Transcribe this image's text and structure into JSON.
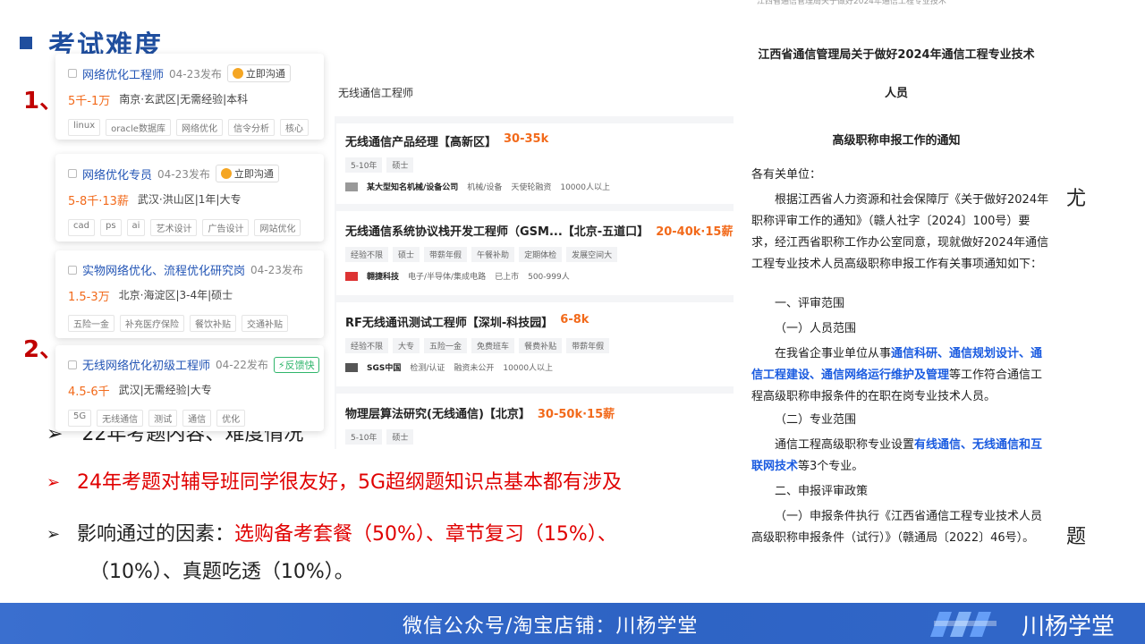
{
  "slide": {
    "title": "考试难度",
    "section_1": "1、",
    "section_2": "2、",
    "partial_right_char": "尤",
    "partial_right_char2": "题"
  },
  "bullets": {
    "hidden_line": "22年考题内容、难度情况",
    "b1": "24年考题对辅导班同学很友好，5G超纲题知识点基本都有涉及",
    "b2_prefix": "影响通过的因素：",
    "b2_red": "选购备考套餐（50%）、章节复习（15%）、",
    "b2_cont": "（10%）、真题吃透（10%）。"
  },
  "left_cards": [
    {
      "title": "网络优化工程师",
      "date": "04-23发布",
      "btn": "立即沟通",
      "salary": "5千-1万",
      "loc": "南京·玄武区|无需经验|本科",
      "tags": [
        "linux",
        "oracle数据库",
        "网络优化",
        "信令分析",
        "核心"
      ]
    },
    {
      "title": "网络优化专员",
      "date": "04-23发布",
      "btn": "立即沟通",
      "salary": "5-8千·13薪",
      "loc": "武汉·洪山区|1年|大专",
      "tags": [
        "cad",
        "ps",
        "ai",
        "艺术设计",
        "广告设计",
        "网站优化"
      ]
    },
    {
      "title": "实物网络优化、流程优化研究岗",
      "date": "04-23发布",
      "salary": "1.5-3万",
      "loc": "北京·海淀区|3-4年|硕士",
      "tags": [
        "五险一金",
        "补充医疗保险",
        "餐饮补贴",
        "交通补贴"
      ]
    },
    {
      "title": "无线网络优化初级工程师",
      "date": "04-22发布",
      "badge": "反馈快",
      "salary": "4.5-6千",
      "loc": "武汉|无需经验|大专",
      "tags": [
        "5G",
        "无线通信",
        "测试",
        "通信",
        "优化"
      ]
    }
  ],
  "search": {
    "query": "无线通信工程师",
    "results": [
      {
        "title": "无线通信产品经理【高新区】",
        "salary": "30-35k",
        "tags": [
          "5-10年",
          "硕士"
        ],
        "company": "某大型知名机械/设备公司",
        "info": [
          "机械/设备",
          "天使轮融资",
          "10000人以上"
        ]
      },
      {
        "title": "无线通信系统协议栈开发工程师（GSM...【北京-五道口】",
        "salary": "20-40k·15薪",
        "tags": [
          "经验不限",
          "硕士",
          "带薪年假",
          "午餐补助",
          "定期体检",
          "发展空间大"
        ],
        "company": "翱捷科技",
        "info": [
          "电子/半导体/集成电路",
          "已上市",
          "500-999人"
        ]
      },
      {
        "title": "RF无线通讯测试工程师【深圳-科技园】",
        "salary": "6-8k",
        "tags": [
          "经验不限",
          "大专",
          "五险一金",
          "免费班车",
          "餐费补贴",
          "带薪年假"
        ],
        "company": "SGS中国",
        "info": [
          "检测/认证",
          "融资未公开",
          "10000人以上"
        ]
      },
      {
        "title": "物理层算法研究(无线通信)【北京】",
        "salary": "30-50k·15薪",
        "tags": [
          "5-10年",
          "硕士"
        ],
        "company": "",
        "info": []
      }
    ]
  },
  "notice": {
    "title_1": "江西省通信管理局关于做好2024年通信工程专业技术",
    "title_2": "人员",
    "title_3": "高级职称申报工作的通知",
    "salutation": "各有关单位：",
    "p1": "根据江西省人力资源和社会保障厅《关于做好2024年职称评审工作的通知》（赣人社字〔2024〕100号）要求，经江西省职称工作办公室同意，现就做好2024年通信工程专业技术人员高级职称申报工作有关事项通知如下：",
    "h1": "一、评审范围",
    "h1a": "（一）人员范围",
    "p2_a": "在我省企事业单位从事",
    "p2_blue": "通信科研、通信规划设计、通信工程建设、通信网络运行维护及管理",
    "p2_b": "等工作符合通信工程高级职称申报条件的在职在岗专业技术人员。",
    "h1b": "（二）专业范围",
    "p3_a": "通信工程高级职称专业设置",
    "p3_blue": "有线通信、无线通信和互联网技术",
    "p3_b": "等3个专业。",
    "h2": "二、申报评审政策",
    "p4": "（一）申报条件执行《江西省通信工程专业技术人员高级职称申报条件（试行）》（赣通局〔2022〕46号）。"
  },
  "footer": {
    "text": "微信公众号/淘宝店铺：川杨学堂",
    "brand": "川杨学堂"
  }
}
